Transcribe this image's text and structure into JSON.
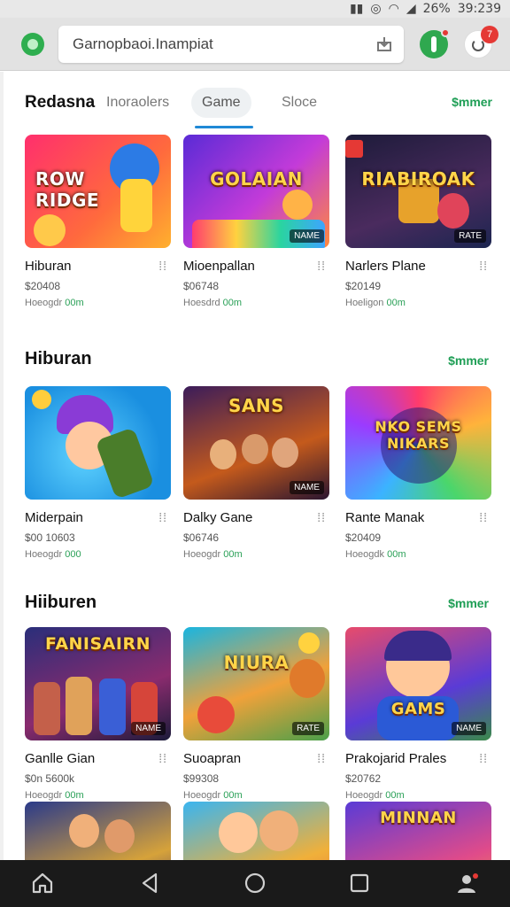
{
  "status": {
    "battery": "26%",
    "time": "39:239"
  },
  "search": {
    "value": "Garnopbaoi.Inampiat"
  },
  "header": {
    "avatar_badge": "7"
  },
  "tabs": [
    {
      "label": "Redasna"
    },
    {
      "label": "Inoraolers"
    },
    {
      "label": "Game"
    },
    {
      "label": "Sloce"
    }
  ],
  "see_more": [
    "$mmer",
    "$mmer",
    "$mmer"
  ],
  "sections": [
    {
      "title": "Hiburan",
      "items": [
        {
          "name": "Hiburan",
          "price": "$20408",
          "meta": "Hoeogdr",
          "meta_hl": "00m",
          "art": "ROW RIDGE",
          "tag": ""
        },
        {
          "name": "Mioenpallan",
          "price": "$06748",
          "meta": "Hoesdrd",
          "meta_hl": "00m",
          "art": "GOLAIAN",
          "tag": "NAME"
        },
        {
          "name": "Narlers Plane",
          "price": "$20149",
          "meta": "Hoeligon",
          "meta_hl": "00m",
          "art": "RIABIROAK",
          "tag": "RATE"
        }
      ]
    },
    {
      "title": "Hiburan",
      "items": [
        {
          "name": "Miderpain",
          "price": "$00 10603",
          "meta": "Hoeogdr",
          "meta_hl": "000",
          "art": "",
          "tag": ""
        },
        {
          "name": "Dalky Gane",
          "price": "$06746",
          "meta": "Hoeogdr",
          "meta_hl": "00m",
          "art": "SANS",
          "tag": "NAME"
        },
        {
          "name": "Rante Manak",
          "price": "$20409",
          "meta": "Hoeogdk",
          "meta_hl": "00m",
          "art": "NKO SEMS NIKARS",
          "tag": ""
        }
      ]
    },
    {
      "title": "Hiiburen",
      "items": [
        {
          "name": "Ganlle Gian",
          "price": "$0n 5600k",
          "meta": "Hoeogdr",
          "meta_hl": "00m",
          "art": "FANISAIRN",
          "tag": "NAME"
        },
        {
          "name": "Suoapran",
          "price": "$99308",
          "meta": "Hoeogdr",
          "meta_hl": "00m",
          "art": "NIURA",
          "tag": "RATE"
        },
        {
          "name": "Prakojarid Prales",
          "price": "$20762",
          "meta": "Hoeogdr",
          "meta_hl": "00m",
          "art": "GAMS",
          "tag": "NAME"
        }
      ]
    },
    {
      "title": "",
      "items": [
        {
          "name": "",
          "price": "",
          "meta": "",
          "meta_hl": "",
          "art": "",
          "tag": ""
        },
        {
          "name": "",
          "price": "",
          "meta": "",
          "meta_hl": "",
          "art": "",
          "tag": ""
        },
        {
          "name": "",
          "price": "",
          "meta": "",
          "meta_hl": "",
          "art": "MINNAN",
          "tag": ""
        }
      ]
    }
  ],
  "nav": [
    "home-icon",
    "back-icon",
    "home-circle-icon",
    "recents-icon",
    "profile-icon"
  ]
}
